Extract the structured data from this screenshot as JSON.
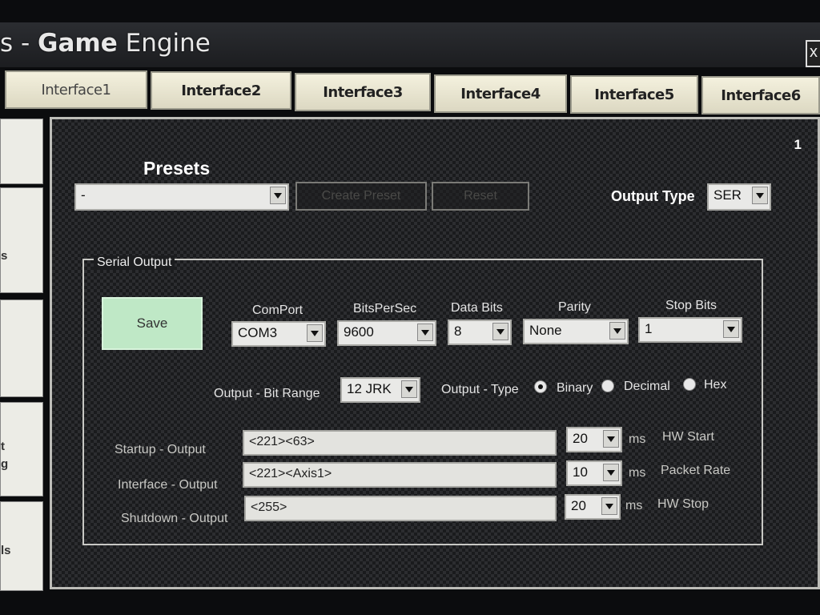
{
  "window": {
    "title_prefix": "s - ",
    "title_bold": "Game",
    "title_rest": " Engine",
    "close_label": "x"
  },
  "tabs": [
    {
      "label": "Interface1"
    },
    {
      "label": "Interface2"
    },
    {
      "label": "Interface3"
    },
    {
      "label": "Interface4"
    },
    {
      "label": "Interface5"
    },
    {
      "label": "Interface6"
    }
  ],
  "side_tabs": [
    {
      "label": ""
    },
    {
      "label": "s"
    },
    {
      "label": ""
    },
    {
      "label": "t\ng"
    },
    {
      "label": "ls"
    }
  ],
  "page_number": "1",
  "presets": {
    "label": "Presets",
    "selected": "-",
    "create_label": "Create Preset",
    "reset_label": "Reset"
  },
  "output_type": {
    "label": "Output Type",
    "value": "SER"
  },
  "serial": {
    "group_title": "Serial Output",
    "save_label": "Save",
    "comport": {
      "label": "ComPort",
      "value": "COM3"
    },
    "bits_per_sec": {
      "label": "BitsPerSec",
      "value": "9600"
    },
    "data_bits": {
      "label": "Data Bits",
      "value": "8"
    },
    "parity": {
      "label": "Parity",
      "value": "None"
    },
    "stop_bits": {
      "label": "Stop Bits",
      "value": "1"
    },
    "bit_range": {
      "label": "Output - Bit Range",
      "value": "12 JRK"
    },
    "output_format": {
      "label": "Output - Type",
      "options": [
        "Binary",
        "Decimal",
        "Hex"
      ],
      "selected": "Binary"
    },
    "rows": [
      {
        "label": "Startup - Output",
        "value": "<221><63>",
        "ms_value": "20",
        "unit": "ms",
        "note": "HW Start"
      },
      {
        "label": "Interface - Output",
        "value": "<221><Axis1>",
        "ms_value": "10",
        "unit": "ms",
        "note": "Packet Rate"
      },
      {
        "label": "Shutdown - Output",
        "value": "<255>",
        "ms_value": "20",
        "unit": "ms",
        "note": "HW Stop"
      }
    ]
  }
}
